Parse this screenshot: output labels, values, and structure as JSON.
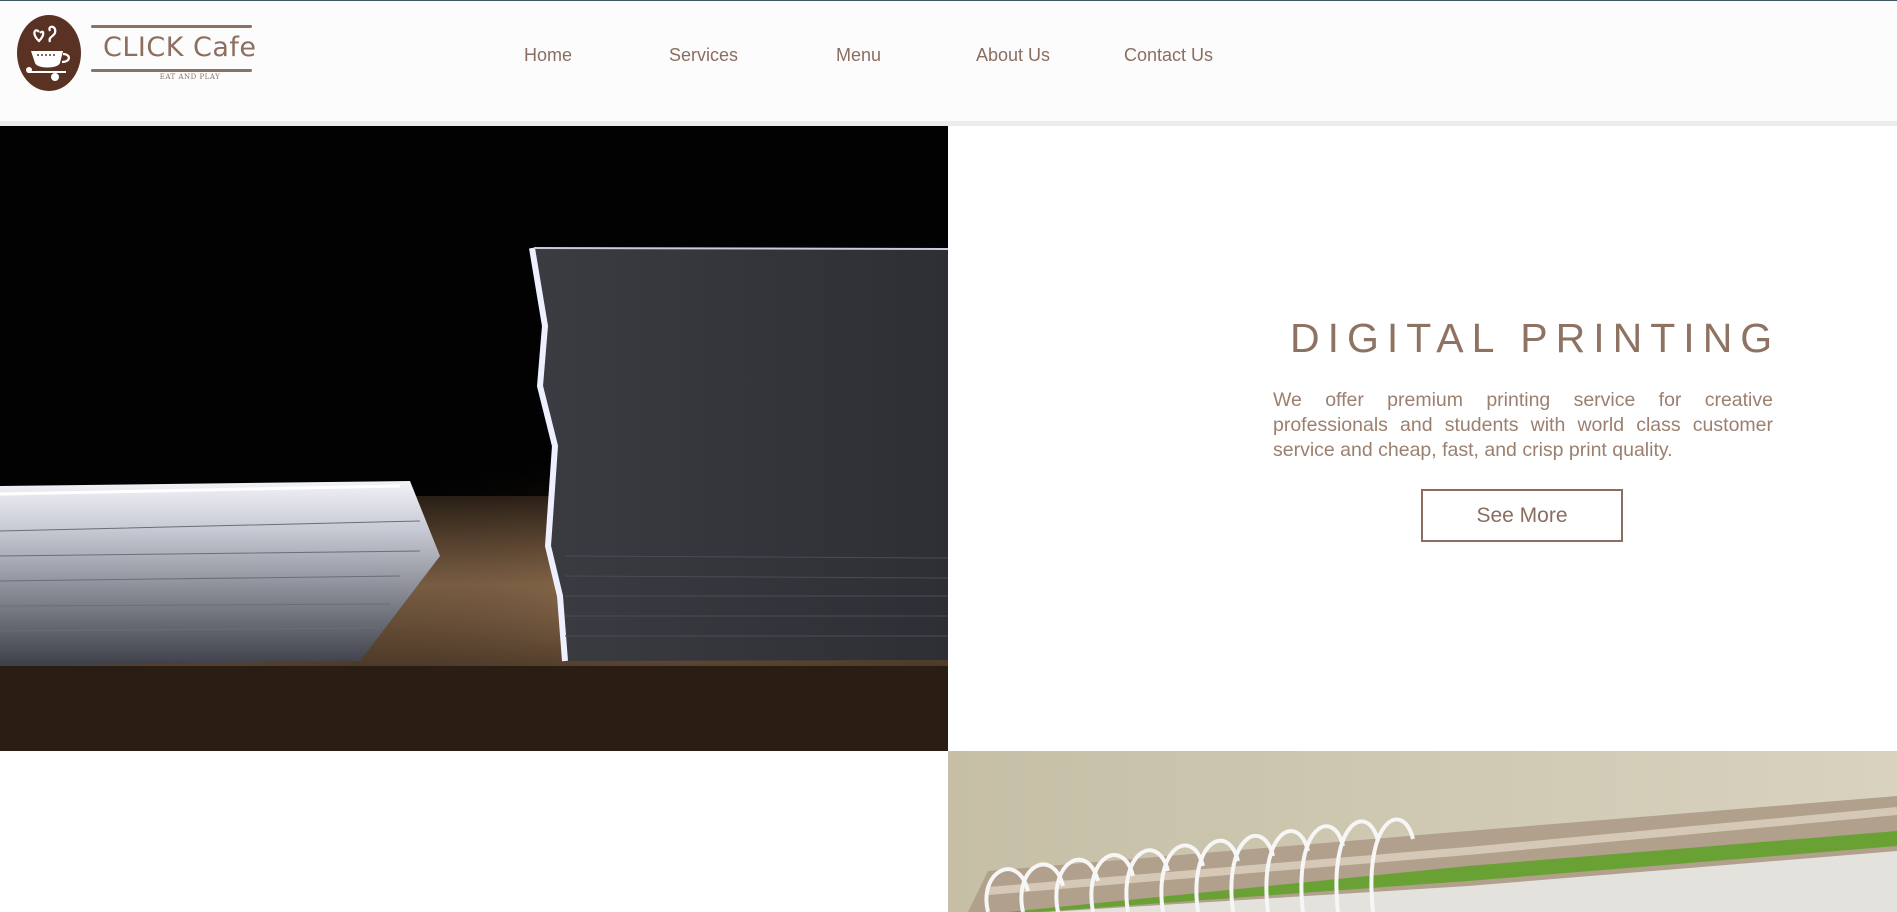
{
  "brand": {
    "name": "CLICK Cafe",
    "tagline": "EAT AND PLAY",
    "colors": {
      "primary": "#8a6e5f",
      "logo_circle": "#5a3224"
    },
    "logo_icon": "coffee-cup-heart-icon"
  },
  "nav": {
    "items": [
      {
        "label": "Home"
      },
      {
        "label": "Services"
      },
      {
        "label": "Menu"
      },
      {
        "label": "About Us"
      },
      {
        "label": "Contact Us"
      }
    ]
  },
  "hero": {
    "image": "stacked-paper-photo",
    "title": "DIGITAL PRINTING",
    "body": "We offer premium printing service for creative professionals and students with world class customer service and cheap, fast, and crisp print quality.",
    "button_label": "See More"
  },
  "secondary": {
    "image": "spiral-notebook-photo"
  }
}
